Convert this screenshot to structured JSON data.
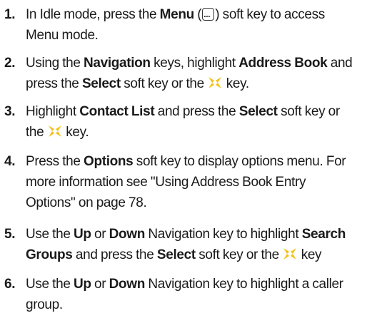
{
  "steps": [
    {
      "number": "1.",
      "lines": [
        [
          "In Idle mode, press the ",
          {
            "b": "Menu"
          },
          " (",
          {
            "icon": "menu-key-icon"
          },
          ") soft key to access"
        ],
        [
          "Menu mode."
        ]
      ]
    },
    {
      "number": "2.",
      "lines": [
        [
          "Using the ",
          {
            "b": "Navigation"
          },
          " keys, highlight ",
          {
            "b": "Address Book"
          },
          " and"
        ],
        [
          "press the ",
          {
            "b": "Select"
          },
          " soft key or the ",
          {
            "icon": "navigation-key-icon"
          },
          " key."
        ]
      ]
    },
    {
      "number": "3.",
      "lines": [
        [
          "Highlight ",
          {
            "b": "Contact List"
          },
          " and press the ",
          {
            "b": "Select"
          },
          " soft key or"
        ],
        [
          "the ",
          {
            "icon": "navigation-key-icon"
          },
          " key."
        ]
      ]
    },
    {
      "number": "4.",
      "lines": [
        [
          "Press the ",
          {
            "b": "Options"
          },
          " soft key to display options menu. For"
        ],
        [
          "more information see \"Using Address Book Entry"
        ],
        [
          "Options\" on page 78."
        ]
      ]
    },
    {
      "number": "5.",
      "lines": [
        [
          "Use the ",
          {
            "b": "Up"
          },
          " or ",
          {
            "b": "Down"
          },
          " Navigation key to highlight ",
          {
            "b": "Search"
          }
        ],
        [
          {
            "b": "Groups"
          },
          " and press the ",
          {
            "b": "Select"
          },
          " soft key or the ",
          {
            "icon": "navigation-key-icon"
          },
          " key"
        ]
      ]
    },
    {
      "number": "6.",
      "lines": [
        [
          "Use the ",
          {
            "b": "Up"
          },
          " or ",
          {
            "b": "Down"
          },
          " Navigation key to highlight a caller"
        ],
        [
          "group."
        ]
      ]
    }
  ],
  "colors": {
    "text": "#1a1a1a",
    "navigation_key_icon": "#f2c21b"
  }
}
